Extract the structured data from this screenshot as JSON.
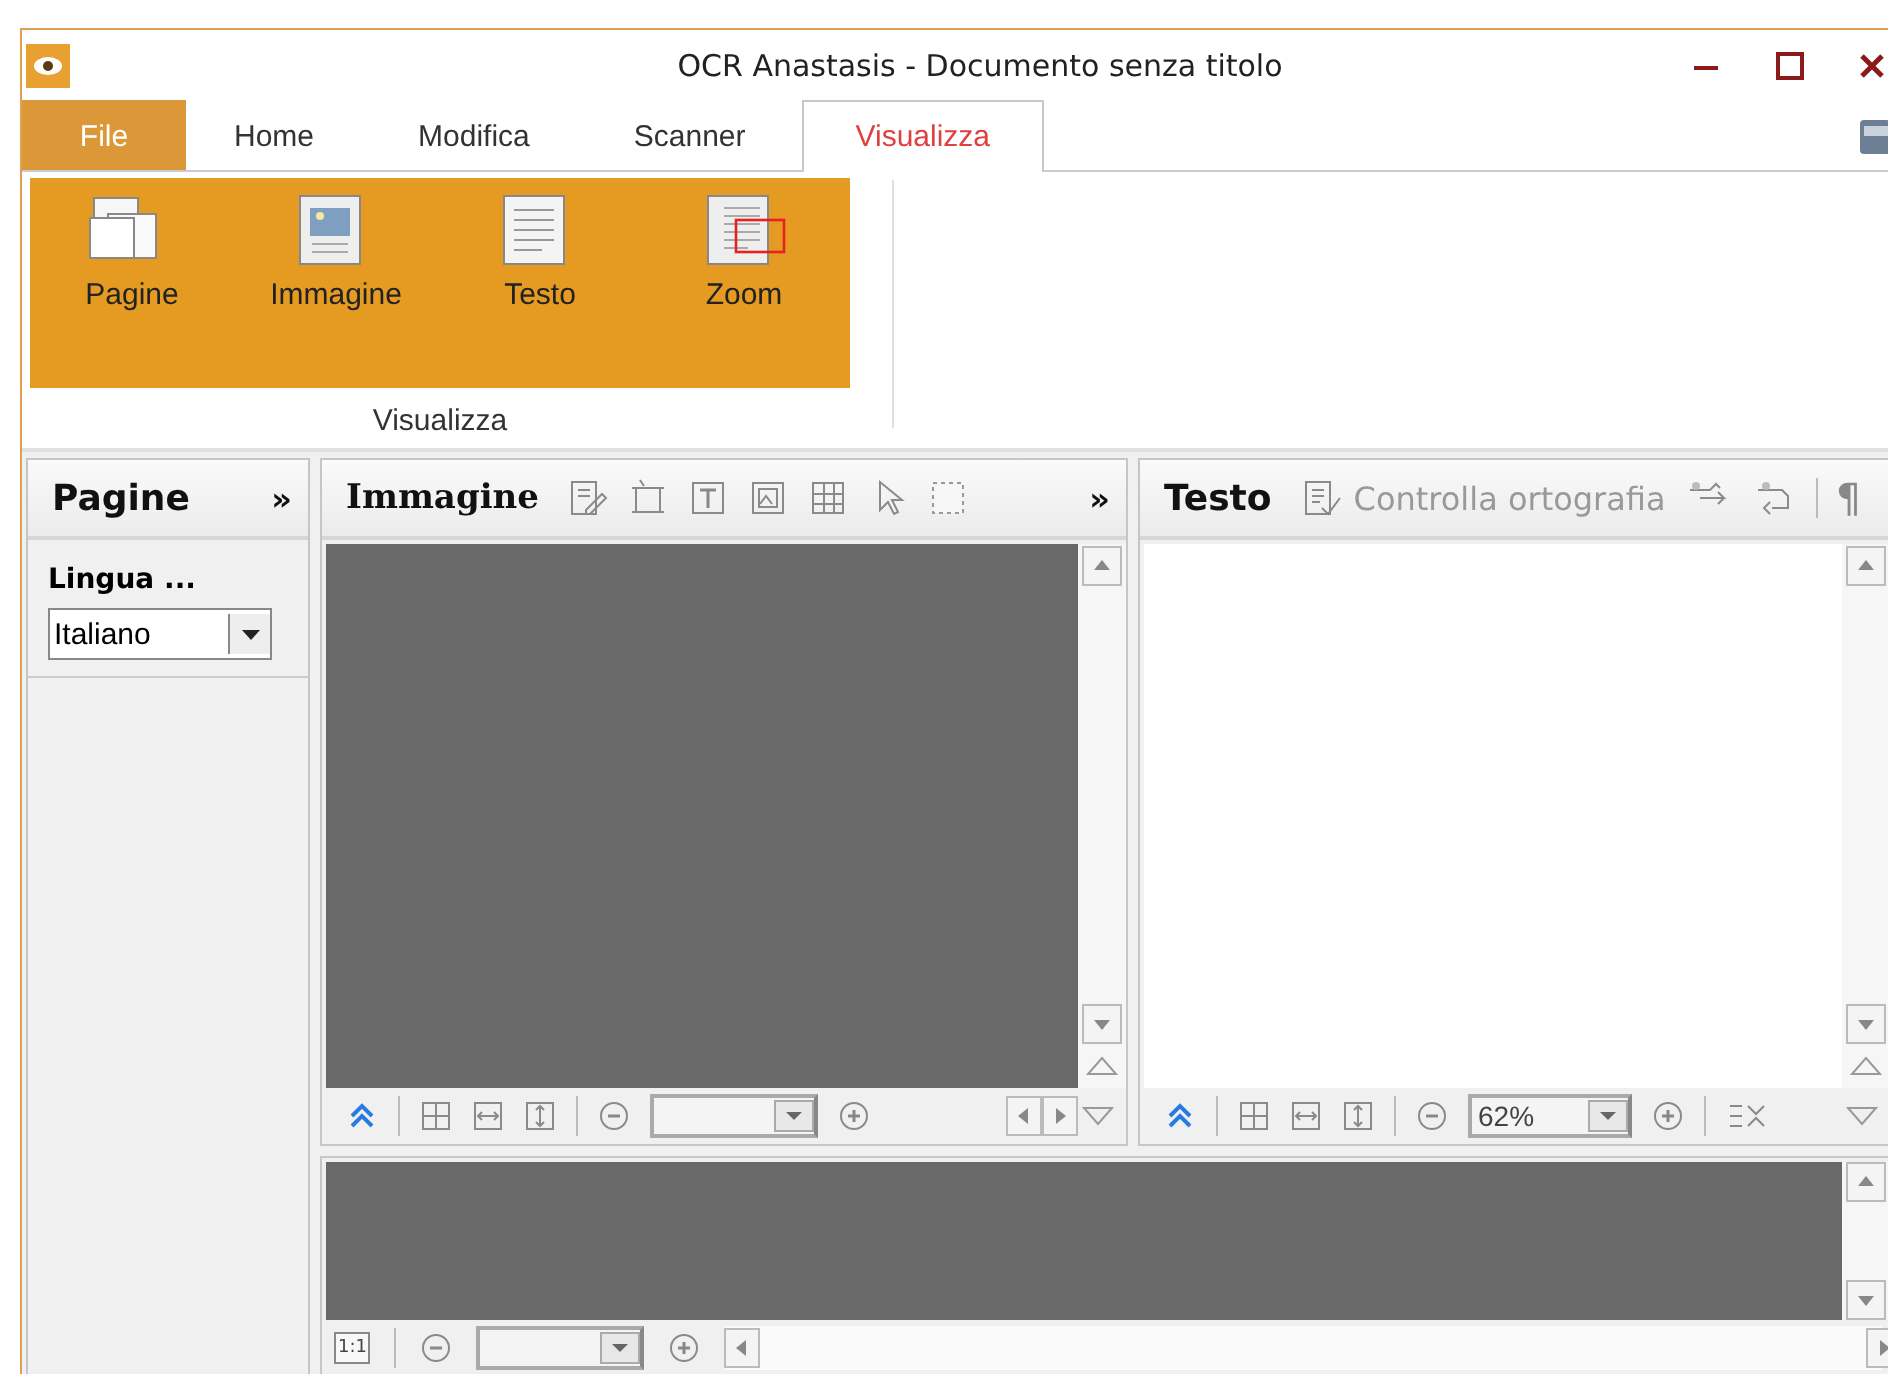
{
  "window": {
    "title": "OCR Anastasis - Documento senza titolo"
  },
  "menu_tabs": [
    {
      "label": "File",
      "kind": "file",
      "selected": false
    },
    {
      "label": "Home",
      "kind": "tab",
      "selected": false
    },
    {
      "label": "Modifica",
      "kind": "tab",
      "selected": false
    },
    {
      "label": "Scanner",
      "kind": "tab",
      "selected": false
    },
    {
      "label": "Visualizza",
      "kind": "tab",
      "selected": true
    }
  ],
  "ribbon": {
    "group": "Visualizza",
    "buttons": [
      {
        "label": "Pagine"
      },
      {
        "label": "Immagine"
      },
      {
        "label": "Testo"
      },
      {
        "label": "Zoom"
      }
    ]
  },
  "pages_panel": {
    "title": "Pagine",
    "collapse": "»",
    "language_label": "Lingua ...",
    "language": "Italiano"
  },
  "image_panel": {
    "title": "Immagine",
    "more": "»"
  },
  "text_panel": {
    "title": "Testo",
    "spellcheck": "Controlla ortografia",
    "pilcrow": "¶",
    "zoom": "62%"
  },
  "thumbnail_panel": {
    "actual_size": "1:1"
  }
}
